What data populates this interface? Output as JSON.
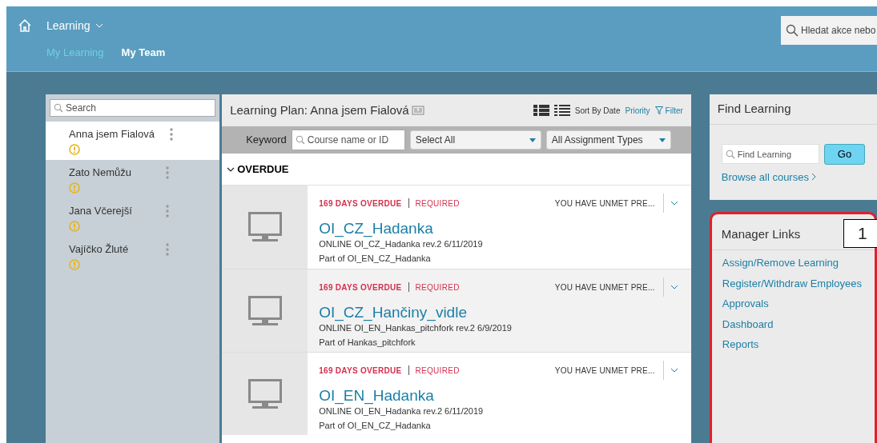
{
  "header": {
    "app_menu": "Learning",
    "search": {
      "placeholder": "Hledat akce nebo"
    },
    "tabs": [
      {
        "label": "My Learning",
        "selected": false
      },
      {
        "label": "My Team",
        "selected": true
      }
    ]
  },
  "people_panel": {
    "search": {
      "placeholder": "Search"
    },
    "people": [
      {
        "name": "Anna jsem Fialová",
        "selected": true,
        "warning": true
      },
      {
        "name": "Zato Nemůžu",
        "selected": false,
        "warning": true
      },
      {
        "name": "Jana Včerejší",
        "selected": false,
        "warning": true
      },
      {
        "name": "Vajíčko Žluté",
        "selected": false,
        "warning": true
      }
    ]
  },
  "plan": {
    "title": "Learning Plan: Anna jsem Fialová",
    "sort_label": "Sort By Date",
    "sort_link": "Priority",
    "filter": "Filter",
    "keyword_label": "Keyword",
    "keyword_placeholder": "Course name or ID",
    "select_all": "Select All",
    "assignment_types": "All Assignment Types",
    "section": {
      "title": "OVERDUE",
      "expanded": true
    },
    "courses": [
      {
        "status": "169 DAYS OVERDUE",
        "required": "REQUIRED",
        "prereq": "YOU HAVE UNMET PRE...",
        "title": "OI_CZ_Hadanka",
        "detail": "ONLINE OI_CZ_Hadanka rev.2 6/11/2019",
        "part_of": "Part of OI_EN_CZ_Hadanka"
      },
      {
        "status": "169 DAYS OVERDUE",
        "required": "REQUIRED",
        "prereq": "YOU HAVE UNMET PRE...",
        "title": "OI_CZ_Hančiny_vidle",
        "detail": "ONLINE OI_EN_Hankas_pitchfork rev.2 6/9/2019",
        "part_of": "Part of Hankas_pitchfork"
      },
      {
        "status": "169 DAYS OVERDUE",
        "required": "REQUIRED",
        "prereq": "YOU HAVE UNMET PRE...",
        "title": "OI_EN_Hadanka",
        "detail": "ONLINE OI_EN_Hadanka rev.2 6/11/2019",
        "part_of": "Part of OI_EN_CZ_Hadanka"
      }
    ]
  },
  "find_learning": {
    "title": "Find Learning",
    "placeholder": "Find Learning",
    "go": "Go",
    "browse": "Browse all courses"
  },
  "manager_links": {
    "title": "Manager Links",
    "callout": "1",
    "links": [
      "Assign/Remove Learning",
      "Register/Withdraw Employees",
      "Approvals",
      "Dashboard",
      "Reports"
    ]
  }
}
